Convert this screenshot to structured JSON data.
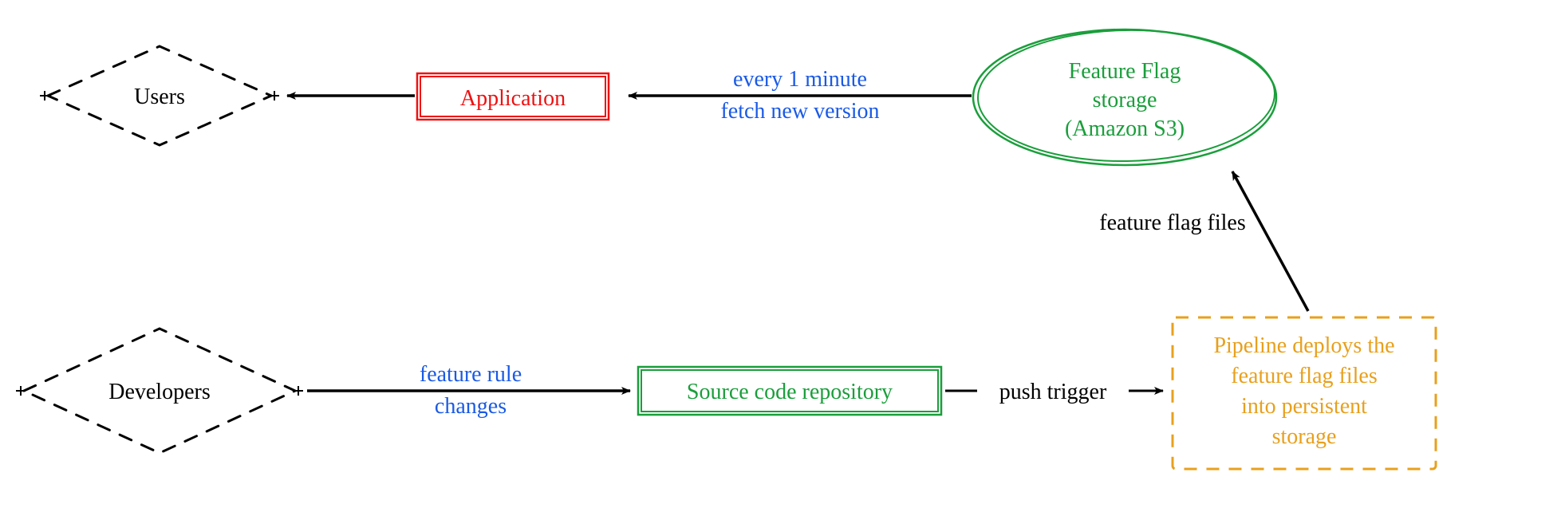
{
  "nodes": {
    "users": {
      "label": "Users",
      "stroke": "#000000",
      "fill": "#000000"
    },
    "application": {
      "label": "Application",
      "stroke": "#e11",
      "fill": "#e11"
    },
    "storage": {
      "line1": "Feature Flag",
      "line2": "storage",
      "line3": "(Amazon S3)",
      "stroke": "#1a9e3b",
      "fill": "#1a9e3b"
    },
    "developers": {
      "label": "Developers",
      "stroke": "#000000",
      "fill": "#000000"
    },
    "repo": {
      "label": "Source code repository",
      "stroke": "#1a9e3b",
      "fill": "#1a9e3b"
    },
    "pipeline": {
      "line1": "Pipeline deploys the",
      "line2": "feature flag files",
      "line3": "into persistent",
      "line4": "storage",
      "stroke": "#e8a01d",
      "fill": "#e8a01d"
    }
  },
  "edges": {
    "app_to_users": {
      "label": ""
    },
    "storage_to_app": {
      "line1": "every 1 minute",
      "line2": "fetch new version",
      "color": "#1a5ae5"
    },
    "dev_to_repo": {
      "line1": "feature rule",
      "line2": "changes",
      "color": "#1a5ae5"
    },
    "repo_to_pipeline": {
      "label": "push trigger",
      "color": "#000000"
    },
    "pipeline_to_storage": {
      "label": "feature flag files",
      "color": "#000000"
    }
  }
}
